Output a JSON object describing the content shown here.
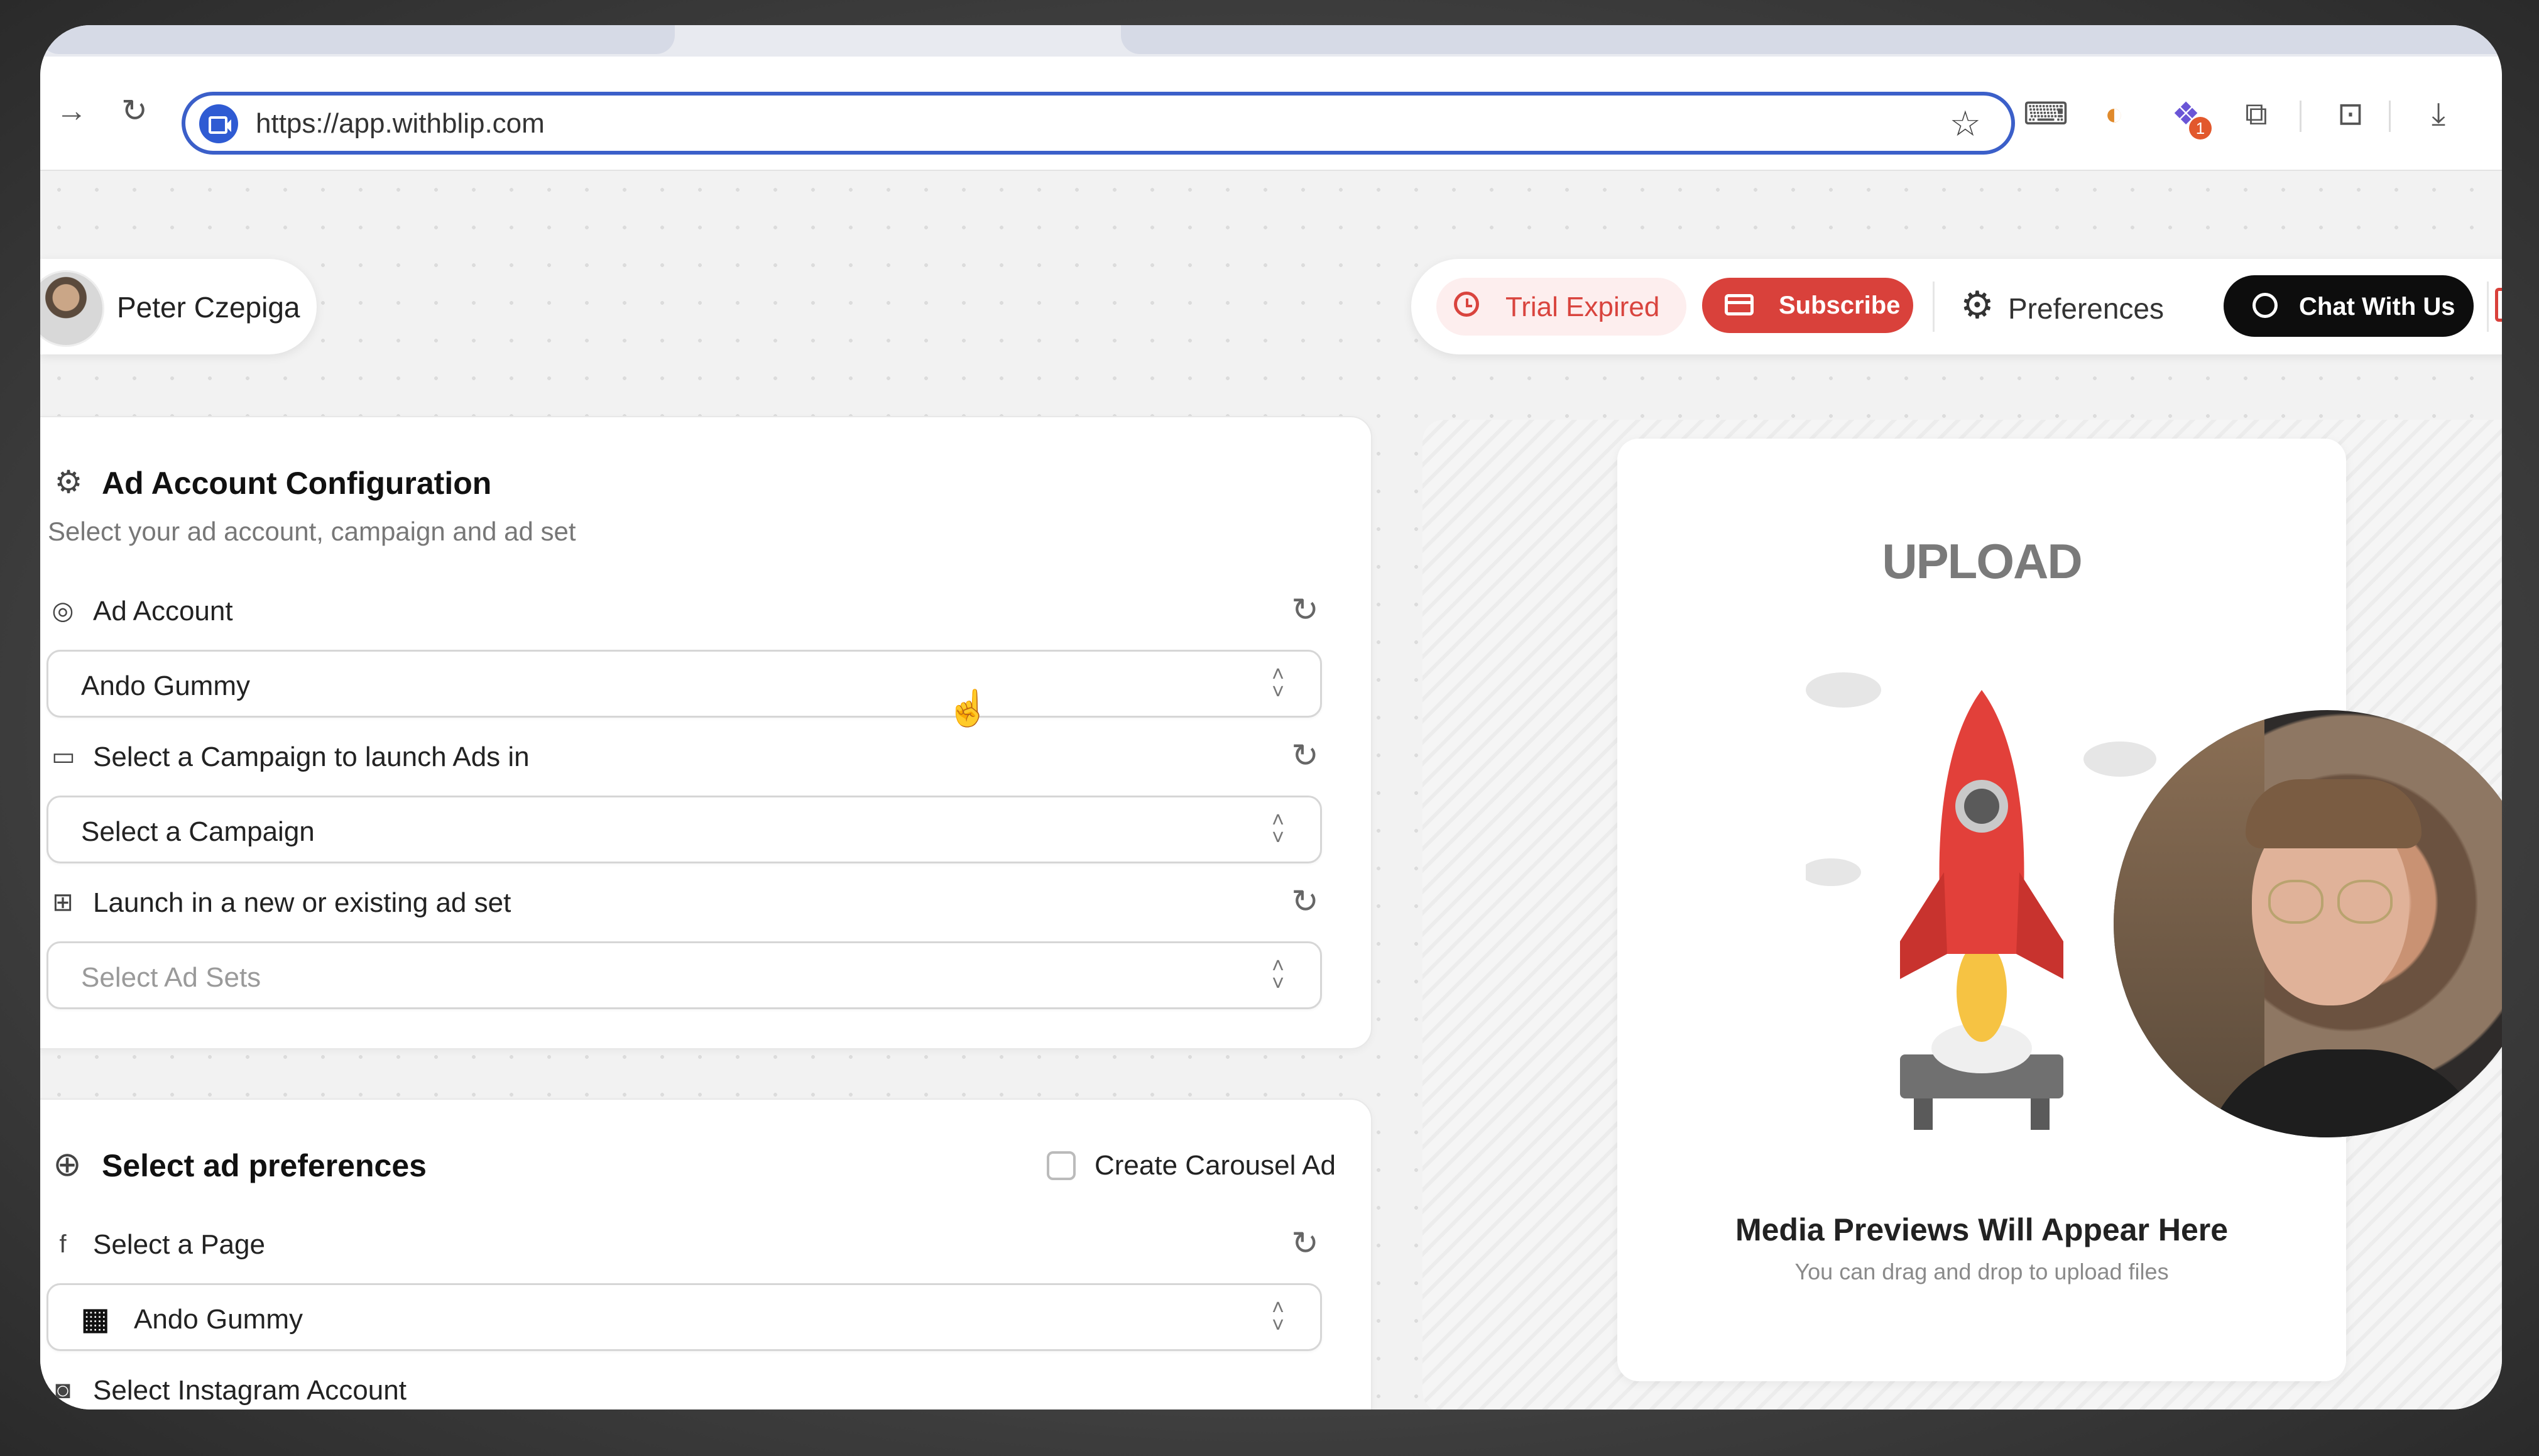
{
  "browser": {
    "url": "https://app.withblip.com"
  },
  "user": {
    "name": "Peter Czepiga"
  },
  "header_actions": {
    "trial_label": "Trial Expired",
    "subscribe_label": "Subscribe",
    "preferences_label": "Preferences",
    "chat_label": "Chat With Us"
  },
  "ad_config": {
    "title": "Ad Account Configuration",
    "subtitle": "Select your ad account, campaign and ad set",
    "ad_account_label": "Ad Account",
    "ad_account_value": "Ando Gummy",
    "campaign_label": "Select a Campaign to launch Ads in",
    "campaign_value": "Select a Campaign",
    "adset_label": "Launch in a new or existing ad set",
    "adset_placeholder": "Select Ad Sets"
  },
  "ad_prefs": {
    "title": "Select ad preferences",
    "carousel_label": "Create Carousel Ad",
    "page_label": "Select a Page",
    "page_value": "Ando Gummy",
    "instagram_label": "Select Instagram Account"
  },
  "preview": {
    "logo": "UPLOAD",
    "title": "Media Previews Will Appear Here",
    "subtitle": "You can drag and drop to upload files"
  },
  "colors": {
    "accent_red": "#d9413b",
    "chat_black": "#0d0d0d",
    "omnibox_blue": "#3b5fc9"
  }
}
